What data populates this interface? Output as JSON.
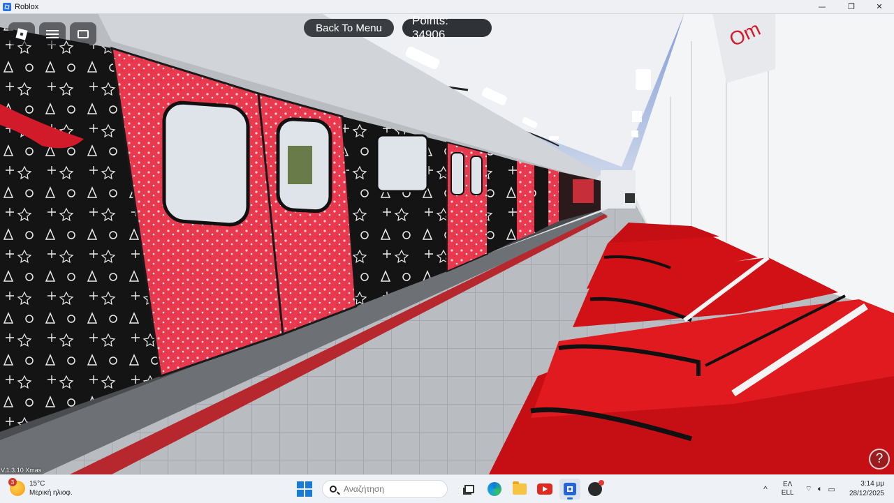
{
  "window": {
    "title": "Roblox",
    "controls": [
      "—",
      "❐",
      "✕"
    ]
  },
  "hud": {
    "back_button": "Back To Menu",
    "points_label": "Points: 34906",
    "version": "V.1.3.10 Xmas",
    "help": "?"
  },
  "scene": {
    "station_sign_text": "Om",
    "train_colors": {
      "red_door": "#e8394f",
      "black_panel": "#141414",
      "platform_stripe": "#b7282e"
    },
    "seat_color": "#d11116"
  },
  "taskbar": {
    "weather": {
      "temp": "15°C",
      "condition": "Μερική ηλιοφ.",
      "badge": "3"
    },
    "search_placeholder": "Αναζήτηση",
    "apps": [
      "task-view-icon",
      "edge-icon",
      "file-explorer-icon",
      "youtube-icon",
      "roblox-icon",
      "obs-icon"
    ],
    "tray": {
      "chevron": "^",
      "lang_top": "ΕΛ",
      "lang_bottom": "ELL",
      "time": "3:14 μμ",
      "date": "28/12/2025"
    }
  }
}
